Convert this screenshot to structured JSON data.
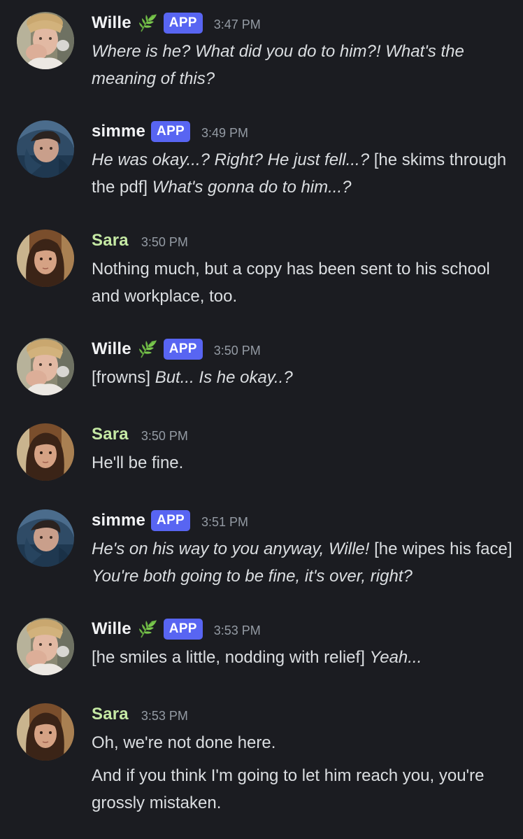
{
  "colors": {
    "background": "#1b1c21",
    "text": "#dbdee1",
    "timestamp": "#949ba4",
    "app_badge": "#5865f2",
    "name_sara": "#c5e9a4",
    "name_default": "#f2f3f5"
  },
  "messages": [
    {
      "author": "Wille",
      "leaf_icon": "herb-emoji-icon",
      "badge": "APP",
      "time": "3:47 PM",
      "lines": [
        [
          {
            "t": "Where is he? What did you do to him?! What's the meaning of this?",
            "i": true
          }
        ]
      ]
    },
    {
      "author": "simme",
      "badge": "APP",
      "time": "3:49 PM",
      "lines": [
        [
          {
            "t": "He was okay...? Right? He just fell...? ",
            "i": true
          },
          {
            "t": "[he skims through the pdf] ",
            "i": false
          },
          {
            "t": "What's gonna do to him...?",
            "i": true
          }
        ]
      ]
    },
    {
      "author": "Sara",
      "time": "3:50 PM",
      "lines": [
        [
          {
            "t": "Nothing much, but a copy has been sent to his school and workplace, too.",
            "i": false
          }
        ]
      ]
    },
    {
      "author": "Wille",
      "leaf_icon": "herb-emoji-icon",
      "badge": "APP",
      "time": "3:50 PM",
      "lines": [
        [
          {
            "t": "[frowns] ",
            "i": false
          },
          {
            "t": "But... Is he okay..?",
            "i": true
          }
        ]
      ]
    },
    {
      "author": "Sara",
      "time": "3:50 PM",
      "lines": [
        [
          {
            "t": "He'll be fine.",
            "i": false
          }
        ]
      ]
    },
    {
      "author": "simme",
      "badge": "APP",
      "time": "3:51 PM",
      "lines": [
        [
          {
            "t": "He's on his way to you anyway, Wille! ",
            "i": true
          },
          {
            "t": "[he wipes his face] ",
            "i": false
          },
          {
            "t": "You're both going to be fine, it's over, right?",
            "i": true
          }
        ]
      ]
    },
    {
      "author": "Wille",
      "leaf_icon": "herb-emoji-icon",
      "badge": "APP",
      "time": "3:53 PM",
      "lines": [
        [
          {
            "t": "[he smiles a little, nodding with relief] ",
            "i": false
          },
          {
            "t": "Yeah...",
            "i": true
          }
        ]
      ]
    },
    {
      "author": "Sara",
      "time": "3:53 PM",
      "lines": [
        [
          {
            "t": "Oh, we're not done here.",
            "i": false
          }
        ],
        [
          {
            "t": "And if you think I'm going to let him reach you, you're grossly mistaken.",
            "i": false
          }
        ]
      ]
    }
  ]
}
